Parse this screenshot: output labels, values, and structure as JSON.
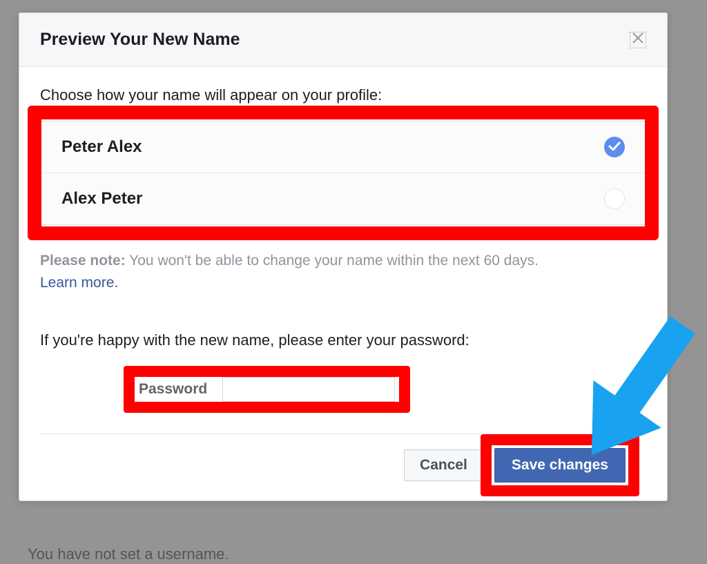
{
  "modal": {
    "title": "Preview Your New Name",
    "choose_text": "Choose how your name will appear on your profile:",
    "options": [
      {
        "label": "Peter Alex",
        "selected": true
      },
      {
        "label": "Alex Peter",
        "selected": false
      }
    ],
    "note_prefix": "Please note:",
    "note_text": " You won't be able to change your name within the next 60 days. ",
    "learn_more": "Learn more",
    "prompt_text": "If you're happy with the new name, please enter your password:",
    "password_label": "Password",
    "cancel_label": "Cancel",
    "save_label": "Save changes"
  },
  "background": {
    "username_text": "You have not set a username."
  }
}
